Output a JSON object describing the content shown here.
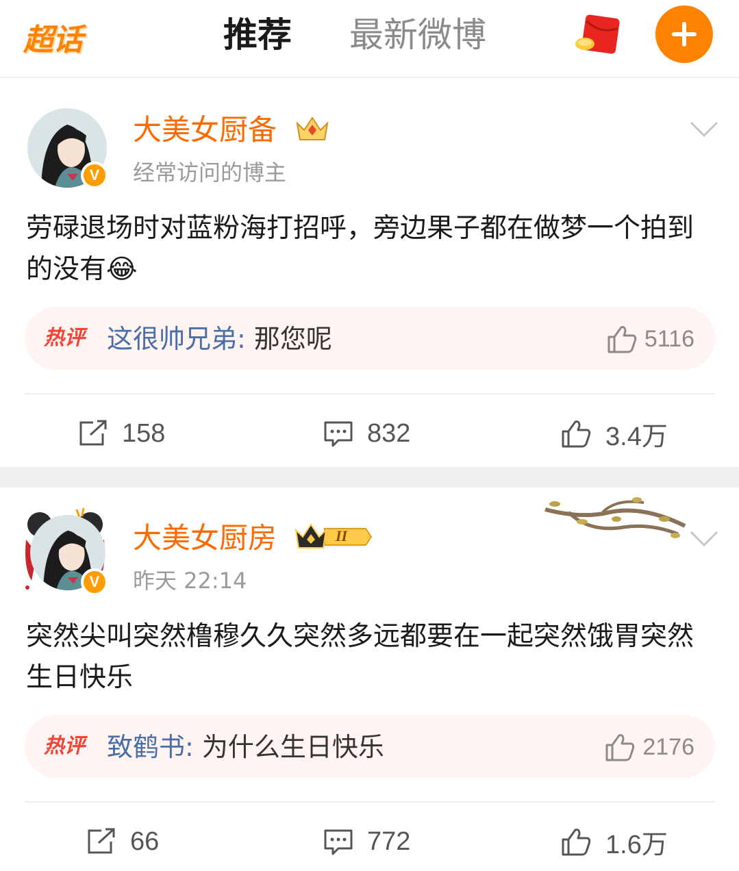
{
  "header": {
    "logo": "超话",
    "tabs": [
      "推荐",
      "最新微博"
    ]
  },
  "posts": [
    {
      "username": "大美女厨备",
      "subtitle": "经常访问的博主",
      "content": "劳碌退场时对蓝粉海打招呼，旁边果子都在做梦一个拍到的没有😂",
      "hot": {
        "label": "热评",
        "name": "这很帅兄弟",
        "colon": ":",
        "text": "那您呢",
        "likes": "5116"
      },
      "reposts": "158",
      "comments": "832",
      "likes": "3.4万"
    },
    {
      "username": "大美女厨房",
      "subtitle": "昨天 22:14",
      "content": "突然尖叫突然橹穆久久突然多远都要在一起突然饿胃突然生日快乐",
      "hot": {
        "label": "热评",
        "name": "致鹤书",
        "colon": ":",
        "text": "为什么生日快乐",
        "likes": "2176"
      },
      "reposts": "66",
      "comments": "772",
      "likes": "1.6万"
    }
  ],
  "badges": {
    "level": "II"
  },
  "colors": {
    "accent": "#ff8200",
    "username": "#ff6a00",
    "hot_bg": "#fff4f1",
    "hot_label": "#f04437",
    "link": "#4a6ea8"
  },
  "icons": [
    "red-packet-icon",
    "plus-icon",
    "verified-v-icon",
    "crown-badge-icon",
    "chevron-down-icon",
    "repost-icon",
    "comment-icon",
    "like-icon"
  ]
}
